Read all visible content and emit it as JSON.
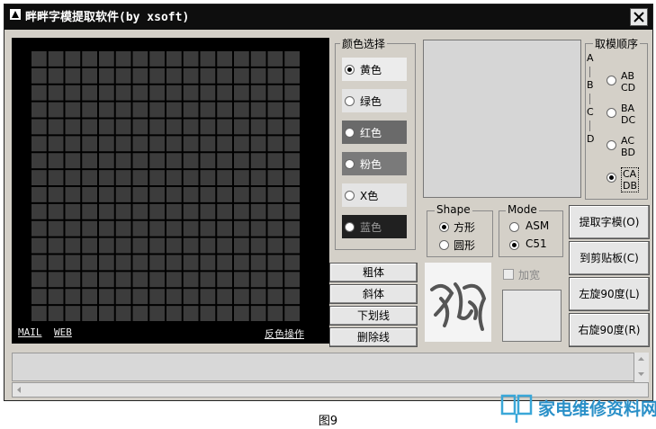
{
  "window": {
    "title": "畔畔字模提取软件(by xsoft)"
  },
  "links": {
    "mail": "MAIL",
    "web": "WEB",
    "invert": "反色操作"
  },
  "color_group": {
    "label": "颜色选择",
    "options": [
      {
        "label": "黄色",
        "selected": true,
        "bg": "#ececec",
        "fg": "#000000"
      },
      {
        "label": "绿色",
        "selected": false,
        "bg": "#e4e4e4",
        "fg": "#000000"
      },
      {
        "label": "红色",
        "selected": false,
        "bg": "#6a6a6a",
        "fg": "#ffffff"
      },
      {
        "label": "粉色",
        "selected": false,
        "bg": "#7a7a7a",
        "fg": "#ffffff"
      },
      {
        "label": "X色",
        "selected": false,
        "bg": "#e4e4e4",
        "fg": "#000000"
      },
      {
        "label": "蓝色",
        "selected": false,
        "bg": "#202020",
        "fg": "#9a9a9a"
      }
    ]
  },
  "order_group": {
    "label": "取模顺序",
    "side_letters": [
      "A",
      "B",
      "C",
      "D"
    ],
    "options": [
      {
        "line1": "AB",
        "line2": "CD",
        "selected": false
      },
      {
        "line1": "BA",
        "line2": "DC",
        "selected": false
      },
      {
        "line1": "AC",
        "line2": "BD",
        "selected": false
      },
      {
        "line1": "CA",
        "line2": "DB",
        "selected": true
      }
    ]
  },
  "shape_group": {
    "label": "Shape",
    "options": [
      {
        "label": "方形",
        "selected": true
      },
      {
        "label": "圆形",
        "selected": false
      }
    ]
  },
  "mode_group": {
    "label": "Mode",
    "options": [
      {
        "label": "ASM",
        "selected": false
      },
      {
        "label": "C51",
        "selected": true
      }
    ]
  },
  "font_style": {
    "buttons": [
      "粗体",
      "斜体",
      "下划线",
      "删除线"
    ]
  },
  "checkbox": {
    "widen": "加宽"
  },
  "actions": {
    "extract": "提取字模(O)",
    "clipboard": "到剪贴板(C)",
    "rotate_left": "左旋90度(L)",
    "rotate_right": "右旋90度(R)"
  },
  "watermark": "家电维修资料网",
  "caption": "图9",
  "grid": {
    "cols": 16,
    "rows": 16,
    "cell_color": "#3c3c3c",
    "bg": "#000000"
  }
}
